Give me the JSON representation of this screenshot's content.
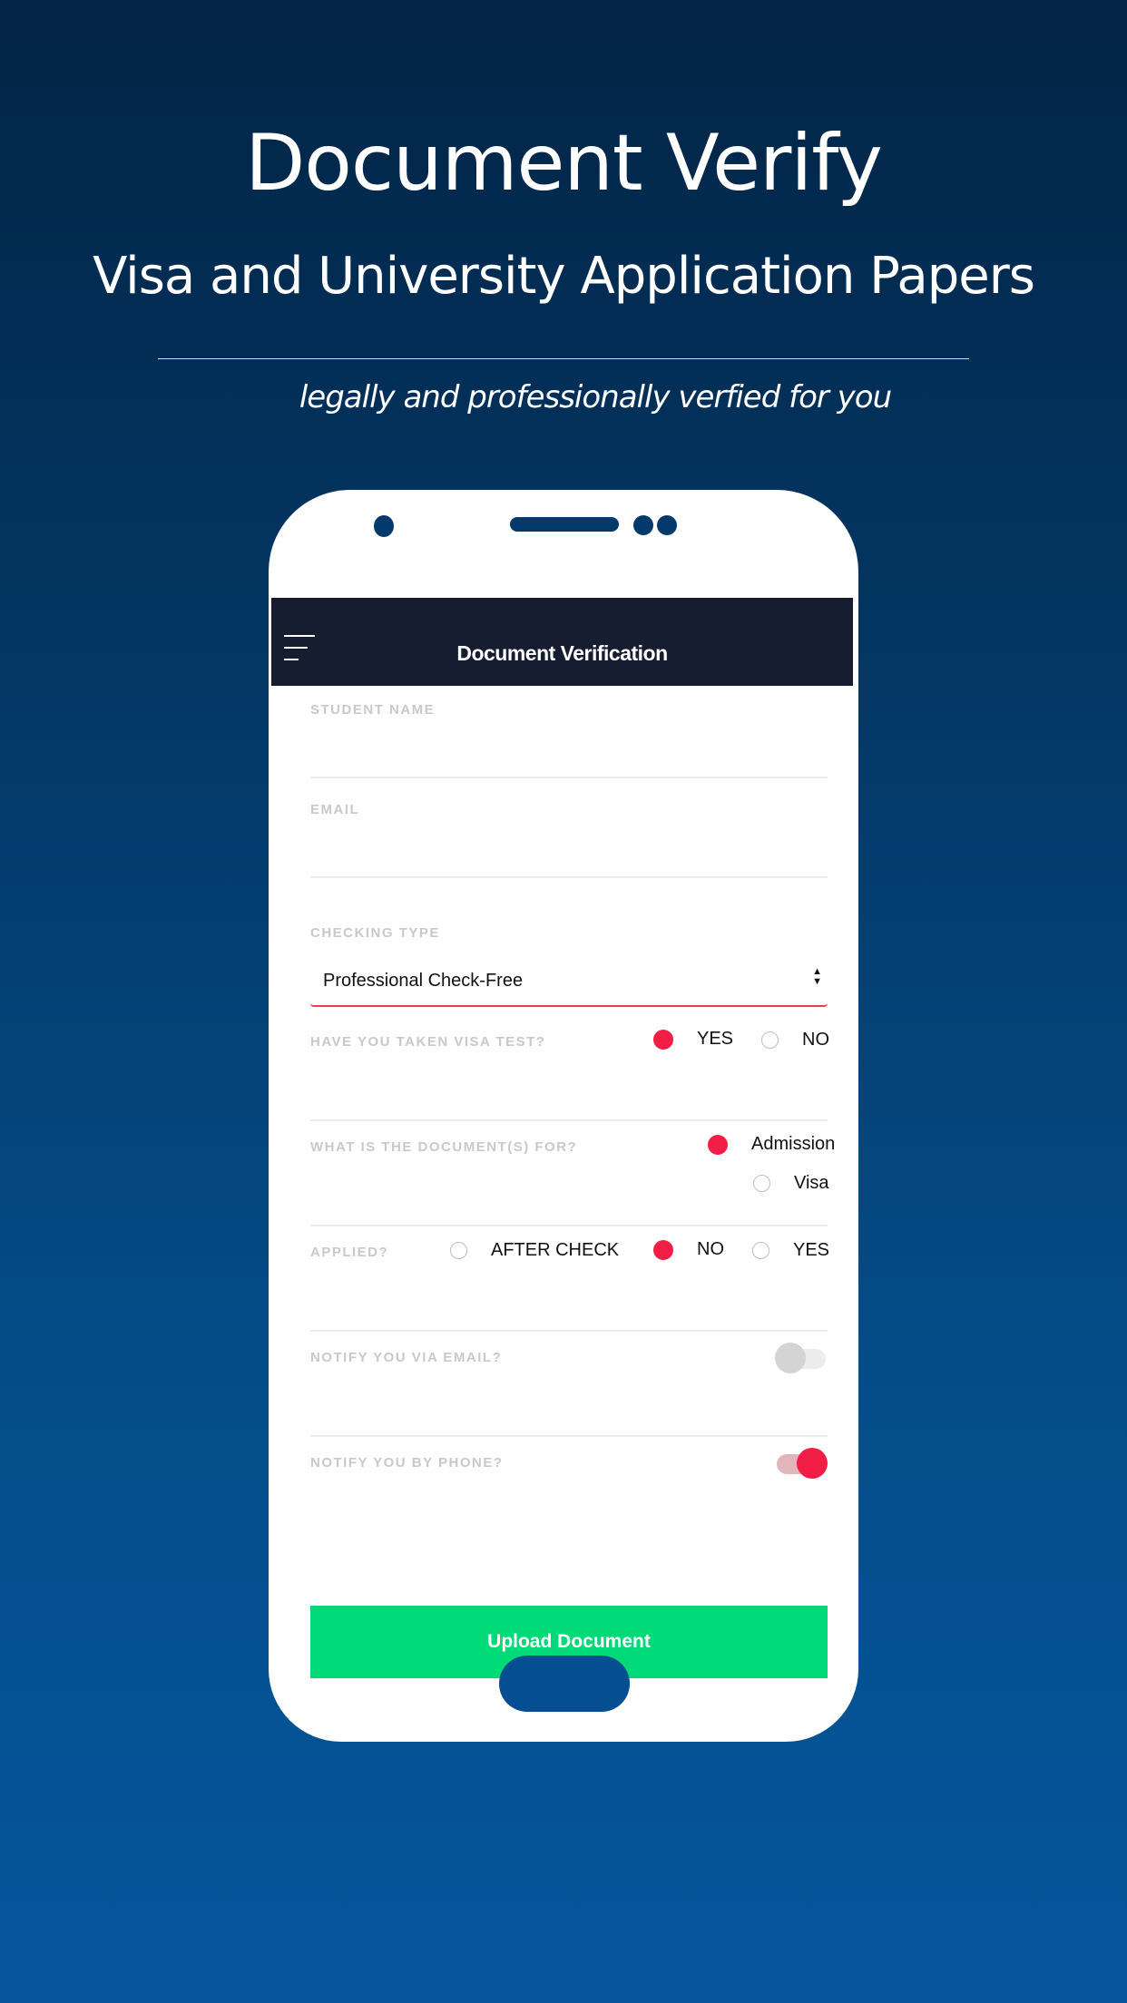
{
  "hero": {
    "title": "Document Verify",
    "subtitle": "Visa and University Application Papers",
    "tagline": "legally and professionally verfied for you"
  },
  "app": {
    "title": "Document Verification",
    "menu_icon": "hamburger-menu-icon"
  },
  "form": {
    "student_name": {
      "label": "STUDENT NAME",
      "value": ""
    },
    "email": {
      "label": "EMAIL",
      "value": ""
    },
    "checking_type": {
      "label": "CHECKING TYPE",
      "selected": "Professional Check-Free",
      "arrows": "▲\n▼"
    },
    "visa_test": {
      "label": "HAVE YOU TAKEN VISA TEST?",
      "options": [
        {
          "label": "YES",
          "selected": true
        },
        {
          "label": "NO",
          "selected": false
        }
      ]
    },
    "document_for": {
      "label": "WHAT IS THE DOCUMENT(S) FOR?",
      "options": [
        {
          "label": "Admission",
          "selected": true
        },
        {
          "label": "Visa",
          "selected": false
        }
      ]
    },
    "applied": {
      "label": "APPLIED?",
      "options": [
        {
          "label": "AFTER CHECK",
          "selected": false
        },
        {
          "label": "NO",
          "selected": true
        },
        {
          "label": "YES",
          "selected": false
        }
      ]
    },
    "notify_email": {
      "label": "NOTIFY YOU VIA EMAIL?",
      "on": false
    },
    "notify_phone": {
      "label": "NOTIFY YOU BY PHONE?",
      "on": true
    },
    "submit_label": "Upload Document"
  },
  "colors": {
    "accent": "#f31e45",
    "button": "#00d977",
    "appbar": "#161d30",
    "toggle_off_knob": "#d4d4d4",
    "toggle_off_track": "#ececec",
    "toggle_on_track": "#e2b5bd"
  }
}
